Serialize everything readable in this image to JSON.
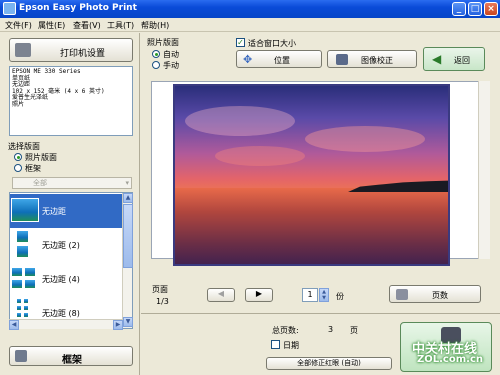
{
  "window": {
    "title": "Epson Easy Photo Print",
    "minimize_symbol": "_",
    "maximize_symbol": "□",
    "close_symbol": "×"
  },
  "menu": [
    "文件(F)",
    "属性(E)",
    "查看(V)",
    "工具(T)",
    "帮助(H)"
  ],
  "sidebar": {
    "printer_settings_label": "打印机设置",
    "printer_info": "EPSON ME 330 Series\n单页纸\n无边距\n102 x 152 毫米 (4 x 6 英寸)\n爱普生光泽纸\n照片",
    "select_layout_heading": "选择版面",
    "radio_photo_layout": "照片版面",
    "radio_frame": "框架",
    "frame_select_value": "全部",
    "layouts": [
      {
        "label": "无边距"
      },
      {
        "label": "无边距 (2)"
      },
      {
        "label": "无边距 (4)"
      },
      {
        "label": "无边距 (8)"
      }
    ],
    "frame_button_label": "框架"
  },
  "main": {
    "photo_layout_heading": "照片版面",
    "radio_auto": "自动",
    "radio_manual": "手动",
    "fit_window_label": "适合窗口大小",
    "position_button": "位置",
    "image_correction_button": "图像校正",
    "back_button": "返回",
    "page_label": "页面",
    "page_indicator": "1/3",
    "copies_value": "1",
    "copies_unit": "份",
    "page_count_button": "页数",
    "total_pages_label": "总页数:",
    "total_pages_value": "3",
    "total_pages_unit": "页",
    "date_label": "日期",
    "correct_all_button": "全部修正红眼 (自动)"
  },
  "watermark": {
    "brand": "中关村在线",
    "domain": "ZOL.com.cn"
  },
  "colors": {
    "title_bar": "#0A4BD8",
    "selected_item": "#316AC5",
    "window_background": "#ECE9D8"
  }
}
